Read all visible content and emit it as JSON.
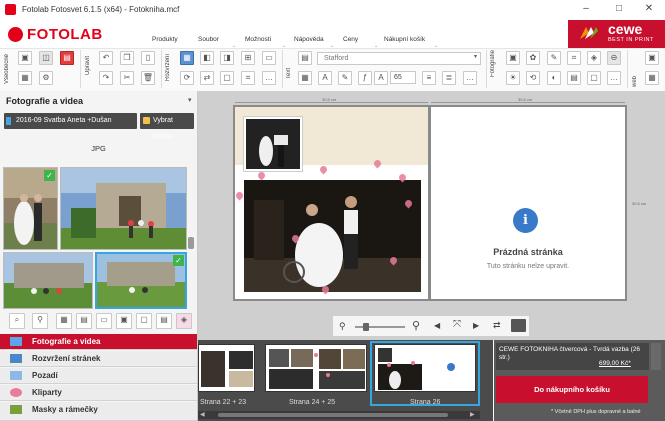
{
  "window": {
    "title": "Fotolab Fotosvet 6.1.5 (x64) - Fotokniha.mcf",
    "controls": [
      "–",
      "□",
      "✕"
    ]
  },
  "brand": {
    "logo_text": "FOTOLAB",
    "partner_top": "cewe",
    "partner_bottom": "BEST IN PRINT"
  },
  "menu": [
    "Produkty",
    "Soubor",
    "Možnosti",
    "Nápověda",
    "Ceny",
    "Nákupní košík"
  ],
  "ribbon": {
    "groups": [
      "Všeobecně",
      "Upravit",
      "Rozvržení",
      "Text",
      "Fotografie",
      "web"
    ],
    "font_name": "Stafford",
    "font_size": "65"
  },
  "left_panel": {
    "title": "Fotografie a videa",
    "folder_button": "2016-09 Svatba Aneta +Dušan",
    "choose_folder_button": "Vybrat složku",
    "file_type_label": "JPG",
    "nav": [
      {
        "label": "Fotografie a videa",
        "active": true,
        "icon": "photo-icon"
      },
      {
        "label": "Rozvržení stránek",
        "active": false,
        "icon": "layout-icon"
      },
      {
        "label": "Pozadí",
        "active": false,
        "icon": "background-icon"
      },
      {
        "label": "Kliparty",
        "active": false,
        "icon": "clipart-icon"
      },
      {
        "label": "Masky a rámečky",
        "active": false,
        "icon": "mask-frame-icon"
      }
    ]
  },
  "workspace": {
    "ruler_left": "30,5 cm",
    "ruler_right": "30,5 cm",
    "ruler_side": "30,5 cm",
    "empty_page_title": "Prázdná stránka",
    "empty_page_subtitle": "Tuto stránku nelze upravit."
  },
  "strip": {
    "pages": [
      "Strana 22 + 23",
      "Strana 24 + 25",
      "Strana 26"
    ]
  },
  "cart": {
    "product": "CEWE FOTOKNIHA čtvercová - Tvrdá vazba (26 str.)",
    "price": "699,00 Kč*",
    "button": "Do nákupního košíku",
    "vat_note": "* Včetně DPH plus dopravné a balné"
  },
  "colors": {
    "accent": "#c8102e",
    "selection": "#35a6e0",
    "check": "#3fb44a",
    "info": "#3979c9"
  }
}
